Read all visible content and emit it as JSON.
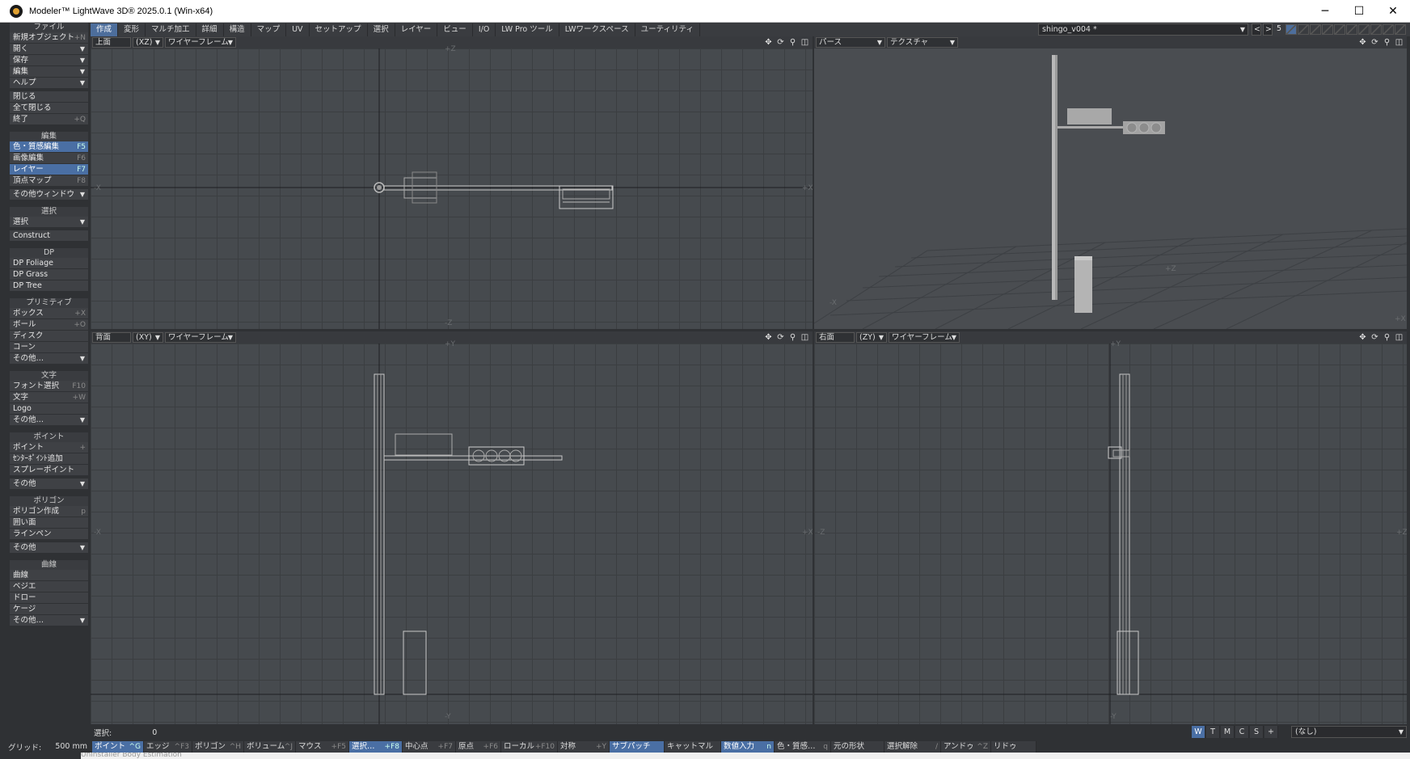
{
  "window": {
    "title": "Modeler™ LightWave 3D® 2025.0.1 (Win-x64)",
    "min": "─",
    "max": "☐",
    "close": "✕"
  },
  "menu_tabs": [
    {
      "label": "作成",
      "active": true
    },
    {
      "label": "変形"
    },
    {
      "label": "マルチ加工"
    },
    {
      "label": "詳細"
    },
    {
      "label": "構造"
    },
    {
      "label": "マップ"
    },
    {
      "label": "UV"
    },
    {
      "label": "セットアップ"
    },
    {
      "label": "選択"
    },
    {
      "label": "レイヤー"
    },
    {
      "label": "ビュー"
    },
    {
      "label": "I/O"
    },
    {
      "label": "LW Pro ツール"
    },
    {
      "label": "LWワークスペース"
    },
    {
      "label": "ユーティリティ"
    }
  ],
  "scene": {
    "name": "shingo_v004 *",
    "layer_num": "5",
    "prev": "<",
    "next": ">"
  },
  "sidebar": {
    "file_header": "ファイル",
    "file_items": [
      {
        "label": "新規オブジェクト",
        "shortcut": "+N"
      },
      {
        "label": "開く",
        "dropdown": true
      },
      {
        "label": "保存",
        "dropdown": true
      },
      {
        "label": "編集",
        "dropdown": true
      },
      {
        "label": "ヘルプ",
        "dropdown": true
      },
      {
        "label": "閉じる"
      },
      {
        "label": "全て閉じる"
      },
      {
        "label": "終了",
        "shortcut": "+Q"
      }
    ],
    "edit_header": "編集",
    "edit_items": [
      {
        "label": "色・質感編集",
        "shortcut": "F5",
        "active": true
      },
      {
        "label": "画像編集",
        "shortcut": "F6"
      },
      {
        "label": "レイヤー",
        "shortcut": "F7",
        "active": true
      },
      {
        "label": "頂点マップ",
        "shortcut": "F8"
      },
      {
        "label": "その他ウィンドウ",
        "dropdown": true
      }
    ],
    "select_header": "選択",
    "select_items": [
      {
        "label": "選択",
        "dropdown": true
      },
      {
        "label": "Construct"
      }
    ],
    "dp_header": "DP",
    "dp_items": [
      {
        "label": "DP Foliage"
      },
      {
        "label": "DP Grass"
      },
      {
        "label": "DP Tree"
      }
    ],
    "prim_header": "プリミティブ",
    "prim_items": [
      {
        "label": "ボックス",
        "shortcut": "+X"
      },
      {
        "label": "ボール",
        "shortcut": "+O"
      },
      {
        "label": "ディスク"
      },
      {
        "label": "コーン"
      },
      {
        "label": "その他…",
        "dropdown": true
      }
    ],
    "text_header": "文字",
    "text_items": [
      {
        "label": "フォント選択",
        "shortcut": "F10"
      },
      {
        "label": "文字",
        "shortcut": "+W"
      },
      {
        "label": "Logo"
      },
      {
        "label": "その他…",
        "dropdown": true
      }
    ],
    "point_header": "ポイント",
    "point_items": [
      {
        "label": "ポイント",
        "shortcut": "+"
      },
      {
        "label": "ｾﾝﾀｰﾎﾟｲﾝﾄ追加"
      },
      {
        "label": "スプレーポイント"
      },
      {
        "label": "その他",
        "dropdown": true
      }
    ],
    "poly_header": "ポリゴン",
    "poly_items": [
      {
        "label": "ポリゴン作成",
        "shortcut": "p"
      },
      {
        "label": "囲い面"
      },
      {
        "label": "ラインペン"
      },
      {
        "label": "その他",
        "dropdown": true
      }
    ],
    "curve_header": "曲線",
    "curve_items": [
      {
        "label": "曲線"
      },
      {
        "label": "ベジエ"
      },
      {
        "label": "ドロー"
      },
      {
        "label": "ケージ"
      },
      {
        "label": "その他…",
        "dropdown": true
      }
    ]
  },
  "viewports": {
    "tl": {
      "view": "上面",
      "axes": "(XZ)",
      "mode": "ワイヤーフレーム",
      "ax_top": "+Z",
      "ax_bottom": "-Z",
      "ax_left": "-X",
      "ax_right": "+X"
    },
    "tr": {
      "view": "パース",
      "mode": "テクスチャ",
      "ax_z": "+Z",
      "ax_x": "-X",
      "ax_x2": "+X"
    },
    "bl": {
      "view": "背面",
      "axes": "(XY)",
      "mode": "ワイヤーフレーム",
      "ax_top": "+Y",
      "ax_bottom": "-Y",
      "ax_left": "-X",
      "ax_right": "+X"
    },
    "br": {
      "view": "右面",
      "axes": "(ZY)",
      "mode": "ワイヤーフレーム",
      "ax_top": "+Y",
      "ax_bottom": "-Y",
      "ax_left": "-Z",
      "ax_right": "+Z"
    }
  },
  "icons": {
    "move": "✥",
    "rotate": "⟳",
    "zoom": "⚲",
    "maximize": "◫"
  },
  "status": {
    "select_label": "選択:",
    "select_count": "0"
  },
  "wtmcs": [
    "W",
    "T",
    "M",
    "C",
    "S",
    "+"
  ],
  "surface_select": "(なし)",
  "bottom": {
    "grid_label": "グリッド:",
    "grid_value": "500 mm",
    "modes": [
      {
        "label": "ポイント",
        "shortcut": "^G",
        "active": true
      },
      {
        "label": "エッジ",
        "shortcut": "^F3"
      },
      {
        "label": "ポリゴン",
        "shortcut": "^H"
      },
      {
        "label": "ボリューム",
        "shortcut": "^J"
      }
    ],
    "actions": [
      {
        "label": "マウス",
        "shortcut": "+F5"
      },
      {
        "label": "選択…",
        "shortcut": "+F8",
        "active": true
      },
      {
        "label": "中心点",
        "shortcut": "+F7"
      },
      {
        "label": "原点",
        "shortcut": "+F6"
      },
      {
        "label": "ローカル",
        "shortcut": "+F10"
      },
      {
        "label": "対称",
        "shortcut": "+Y"
      },
      {
        "label": "サブパッチ",
        "active": true
      },
      {
        "label": "キャットマル"
      },
      {
        "label": "数値入力",
        "shortcut": "n",
        "active": true
      },
      {
        "label": "色・質感…",
        "shortcut": "q"
      },
      {
        "label": "元の形状"
      },
      {
        "label": "選択解除",
        "shortcut": "/"
      },
      {
        "label": "アンドゥ",
        "shortcut": "^Z"
      },
      {
        "label": "リドゥ"
      }
    ]
  },
  "taskbar_text": "Uninstaller      Body Estimation"
}
